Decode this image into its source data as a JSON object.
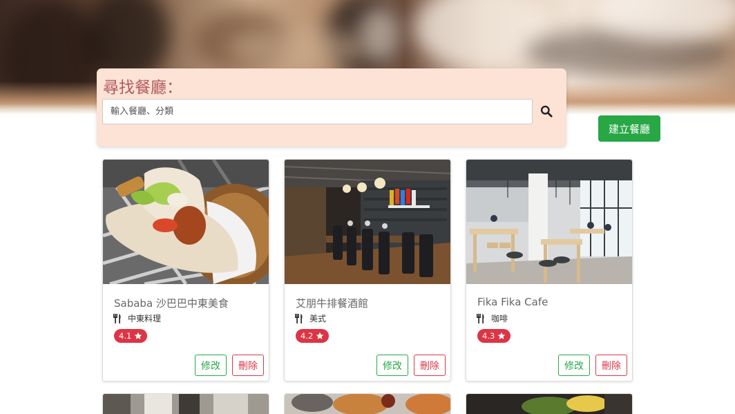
{
  "search": {
    "title": "尋找餐廳：",
    "placeholder": "輸入餐廳、分類",
    "search_icon": "search-icon"
  },
  "create_button": "建立餐廳",
  "restaurants": [
    {
      "name": "Sababa 沙巴巴中東美食",
      "category": "中東料理",
      "rating": "4.1",
      "edit": "修改",
      "delete": "刪除"
    },
    {
      "name": "艾朋牛排餐酒館",
      "category": "美式",
      "rating": "4.2",
      "edit": "修改",
      "delete": "刪除"
    },
    {
      "name": "Fika Fika Cafe",
      "category": "咖啡",
      "rating": "4.3",
      "edit": "修改",
      "delete": "刪除"
    }
  ],
  "icons": {
    "category": "utensils-icon",
    "rating": "star-icon"
  },
  "colors": {
    "search_panel_bg": "#fde2d6",
    "search_title": "#b05a5a",
    "primary_green": "#28a745",
    "danger_red": "#dc3545"
  }
}
